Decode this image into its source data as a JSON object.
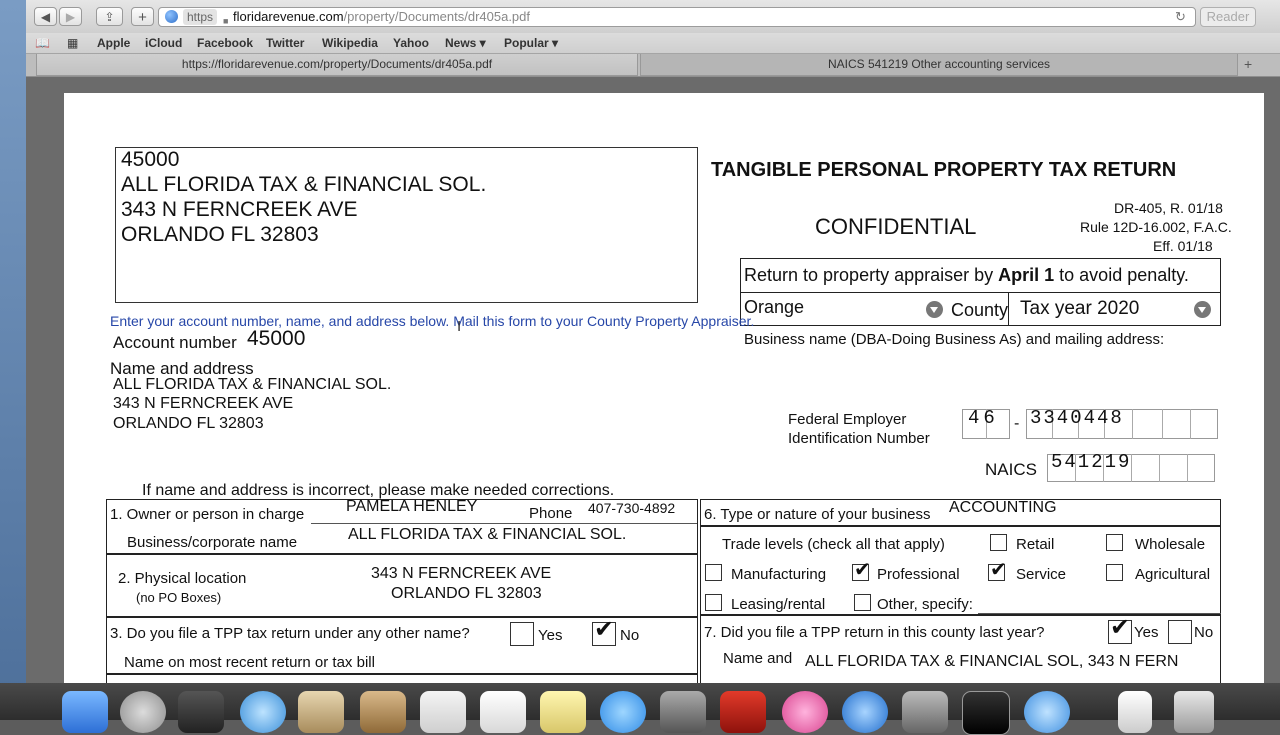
{
  "browser": {
    "url_protocol": "https",
    "url_host": "floridarevenue.com",
    "url_path": "/property/Documents/dr405a.pdf",
    "reader_label": "Reader",
    "bookmarks": [
      "Apple",
      "iCloud",
      "Facebook",
      "Twitter",
      "Wikipedia",
      "Yahoo",
      "News ▾",
      "Popular ▾"
    ],
    "tabs": [
      {
        "label": "https://floridarevenue.com/property/Documents/dr405a.pdf"
      },
      {
        "label": "NAICS 541219 Other accounting services"
      }
    ]
  },
  "form": {
    "title": "TANGIBLE PERSONAL PROPERTY TAX RETURN",
    "confidential": "CONFIDENTIAL",
    "form_id": "DR-405, R. 01/18",
    "rule": "Rule 12D-16.002, F.A.C.",
    "eff": "Eff.  01/18",
    "return_note_pre": "Return to property appraiser by ",
    "return_note_bold": "April 1",
    "return_note_post": " to avoid penalty.",
    "county_value": "Orange",
    "county_label": "County",
    "tax_year": "Tax year 2020",
    "business_name_label": "Business name (DBA-Doing Business As) and mailing address:",
    "address_box": [
      "45000",
      "ALL FLORIDA TAX & FINANCIAL SOL.",
      "343 N FERNCREEK AVE",
      "ORLANDO FL 32803"
    ],
    "instruction": "Enter your account number, name, and address below.  Mail this form to your County Property Appraiser.",
    "account_label": "Account number",
    "account_value": "45000",
    "name_addr_label": "Name and address",
    "name_addr_lines": [
      "ALL FLORIDA TAX & FINANCIAL SOL.",
      "343 N FERNCREEK AVE",
      "ORLANDO FL 32803"
    ],
    "fein_label1": "Federal Employer",
    "fein_label2": "Identification Number",
    "fein_prefix": "46",
    "fein_dash": "-",
    "fein_suffix": "3340448",
    "naics_label": "NAICS",
    "naics_value": "541219",
    "incorrect_note": "If name and address is incorrect, please make needed corrections.",
    "s1_label": "1.  Owner or person in charge",
    "s1_owner": "PAMELA HENLEY",
    "s1_phone_label": "Phone",
    "s1_phone": "407-730-4892",
    "s1_corp_label": "Business/corporate name",
    "s1_corp": "ALL FLORIDA TAX & FINANCIAL SOL.",
    "s2_label": "2. Physical location",
    "s2_sub": "(no PO Boxes)",
    "s2_line1": "343 N FERNCREEK AVE",
    "s2_line2": "ORLANDO FL 32803",
    "s3_label": "3. Do you file a TPP tax return under any other name?",
    "s3_yes": "Yes",
    "s3_no": "No",
    "s3_name_label": "Name on most recent return or tax bill",
    "s6_label": "6. Type or nature of your business",
    "s6_value": "ACCOUNTING",
    "trade_levels": "Trade levels  (check all that apply)",
    "tl_retail": "Retail",
    "tl_wholesale": "Wholesale",
    "tl_manufacturing": "Manufacturing",
    "tl_professional": "Professional",
    "tl_service": "Service",
    "tl_agricultural": "Agricultural",
    "tl_leasing": "Leasing/rental",
    "tl_other": "Other, specify:",
    "s7_label": "7. Did you file a TPP return in this county last year?",
    "s7_yes": "Yes",
    "s7_no": "No",
    "s7_name_label": "Name and",
    "s7_name_value": "ALL FLORIDA TAX & FINANCIAL SOL, 343 N FERN"
  }
}
